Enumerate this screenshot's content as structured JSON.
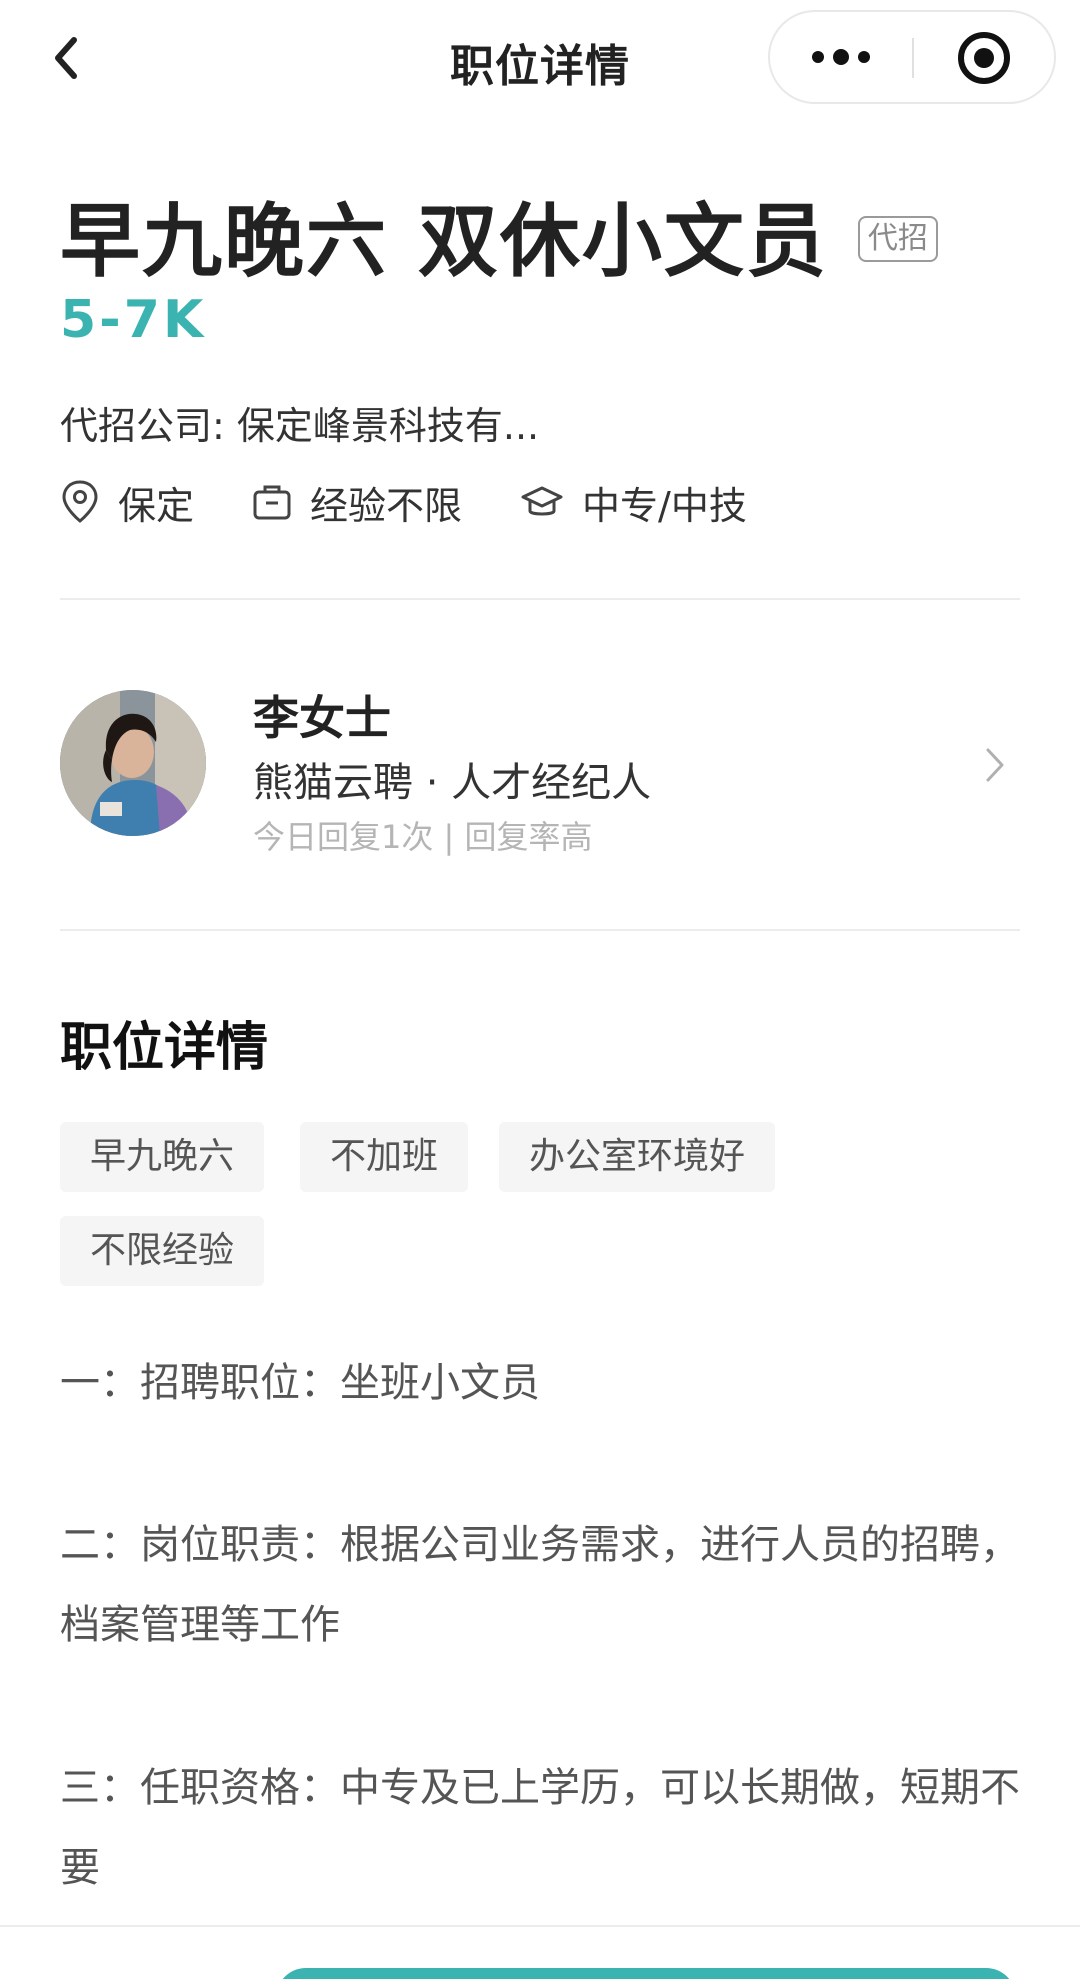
{
  "nav": {
    "title": "职位详情"
  },
  "job": {
    "title": "早九晚六 双休小文员",
    "agency_tag": "代招",
    "salary": "5-7K",
    "company": "代招公司: 保定峰景科技有...",
    "location": "保定",
    "experience": "经验不限",
    "education": "中专/中技"
  },
  "recruiter": {
    "name": "李女士",
    "role": "熊猫云聘 · 人才经纪人",
    "stats": "今日回复1次 | 回复率高"
  },
  "details": {
    "title": "职位详情",
    "tags": [
      "早九晚六",
      "不加班",
      "办公室环境好",
      "不限经验"
    ],
    "paragraphs": [
      "一：招聘职位：坐班小文员",
      "二：岗位职责：根据公司业务需求，进行人员的招聘，档案管理等工作",
      "三：任职资格：中专及已上学历，可以长期做，短期不要"
    ]
  },
  "colors": {
    "accent": "#3bb3b0",
    "tag_bg": "#f5f5f5"
  }
}
